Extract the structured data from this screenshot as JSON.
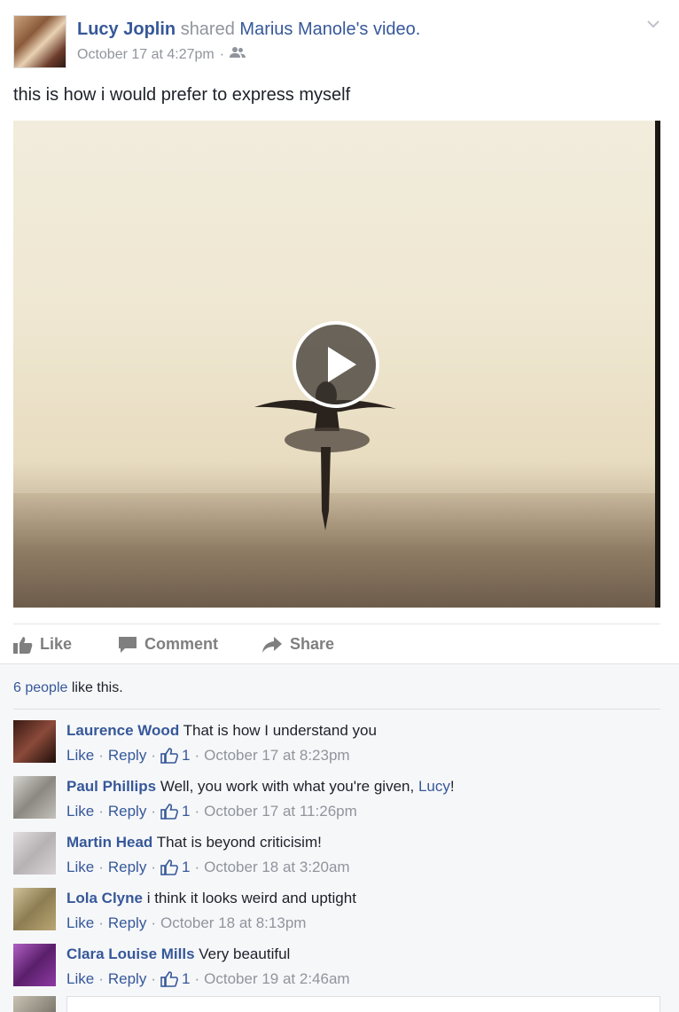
{
  "post": {
    "author": "Lucy Joplin",
    "shared_word": "shared",
    "shared_owner": "Marius Manole's",
    "shared_object": "video.",
    "timestamp": "October 17 at 4:27pm",
    "meta_separator": "·",
    "privacy_icon": "friends-icon",
    "text": "this is how i would prefer to express myself"
  },
  "video": {
    "play_icon": "play-icon"
  },
  "actions": {
    "like": "Like",
    "comment": "Comment",
    "share": "Share"
  },
  "likes_summary": {
    "people": "6 people",
    "suffix": " like this."
  },
  "comments": [
    {
      "name": "Laurence Wood",
      "text": "That is how I understand you",
      "like": "Like",
      "reply": "Reply",
      "likes": "1",
      "time": "October 17 at 8:23pm",
      "avatar_color": "#5a2a22"
    },
    {
      "name": "Paul Phillips",
      "text": "Well, you work with what you're given, ",
      "mention": "Lucy",
      "after": "!",
      "like": "Like",
      "reply": "Reply",
      "likes": "1",
      "time": "October 17 at 11:26pm",
      "avatar_color": "#9b9b95"
    },
    {
      "name": "Martin Head",
      "text": "That is beyond criticisim!",
      "like": "Like",
      "reply": "Reply",
      "likes": "1",
      "time": "October 18 at 3:20am",
      "avatar_color": "#c7c3c5"
    },
    {
      "name": "Lola Clyne",
      "text": "i think it looks weird and uptight",
      "like": "Like",
      "reply": "Reply",
      "likes": "",
      "time": "October 18 at 8:13pm",
      "avatar_color": "#a2936c"
    },
    {
      "name": "Clara Louise Mills",
      "text": "Very beautiful",
      "like": "Like",
      "reply": "Reply",
      "likes": "1",
      "time": "October 19 at 2:46am",
      "avatar_color": "#7a3a8a"
    }
  ],
  "colors": {
    "link": "#365899",
    "muted": "#90949c",
    "comments_bg": "#f6f7f9"
  }
}
